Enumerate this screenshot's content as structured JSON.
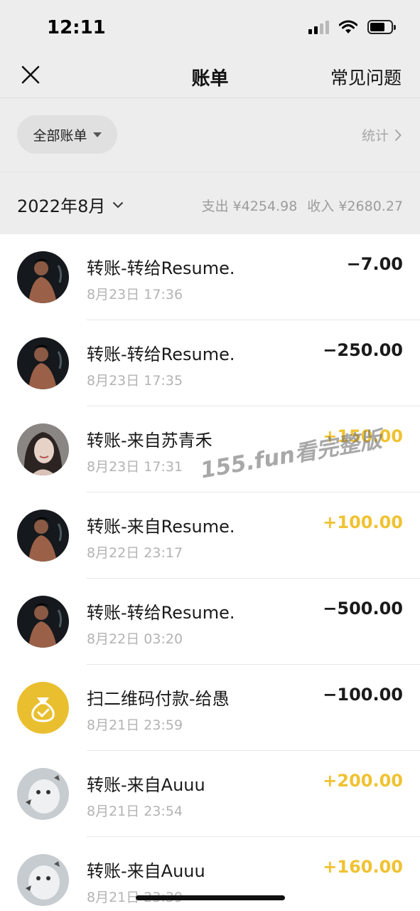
{
  "status_bar": {
    "time": "12:11"
  },
  "nav": {
    "title": "账单",
    "faq_label": "常见问题"
  },
  "filter": {
    "label": "全部账单",
    "stats_label": "统计"
  },
  "month": {
    "label": "2022年8月",
    "expense": "支出 ¥4254.98",
    "income": "收入 ¥2680.27"
  },
  "watermark": "155.fun看完整版",
  "transactions": [
    {
      "title": "转账-转给Resume.",
      "time": "8月23日 17:36",
      "amount": "−7.00",
      "type": "expense",
      "avatar": "dark-avatar"
    },
    {
      "title": "转账-转给Resume.",
      "time": "8月23日 17:35",
      "amount": "−250.00",
      "type": "expense",
      "avatar": "dark-avatar"
    },
    {
      "title": "转账-来自苏青禾",
      "time": "8月23日 17:31",
      "amount": "+150.00",
      "type": "income",
      "avatar": "portrait-avatar"
    },
    {
      "title": "转账-来自Resume.",
      "time": "8月22日 23:17",
      "amount": "+100.00",
      "type": "income",
      "avatar": "dark-avatar"
    },
    {
      "title": "转账-转给Resume.",
      "time": "8月22日 03:20",
      "amount": "−500.00",
      "type": "expense",
      "avatar": "dark-avatar"
    },
    {
      "title": "扫二维码付款-给愚",
      "time": "8月21日 23:59",
      "amount": "−100.00",
      "type": "expense",
      "avatar": "money-bag-icon"
    },
    {
      "title": "转账-来自Auuu",
      "time": "8月21日 23:54",
      "amount": "+200.00",
      "type": "income",
      "avatar": "cat-avatar"
    },
    {
      "title": "转账-来自Auuu",
      "time": "8月21日 23:39",
      "amount": "+160.00",
      "type": "income",
      "avatar": "cat-avatar"
    }
  ],
  "colors": {
    "income": "#f0c232",
    "header_bg": "#ededed",
    "money_bag": "#e9bf2f"
  }
}
